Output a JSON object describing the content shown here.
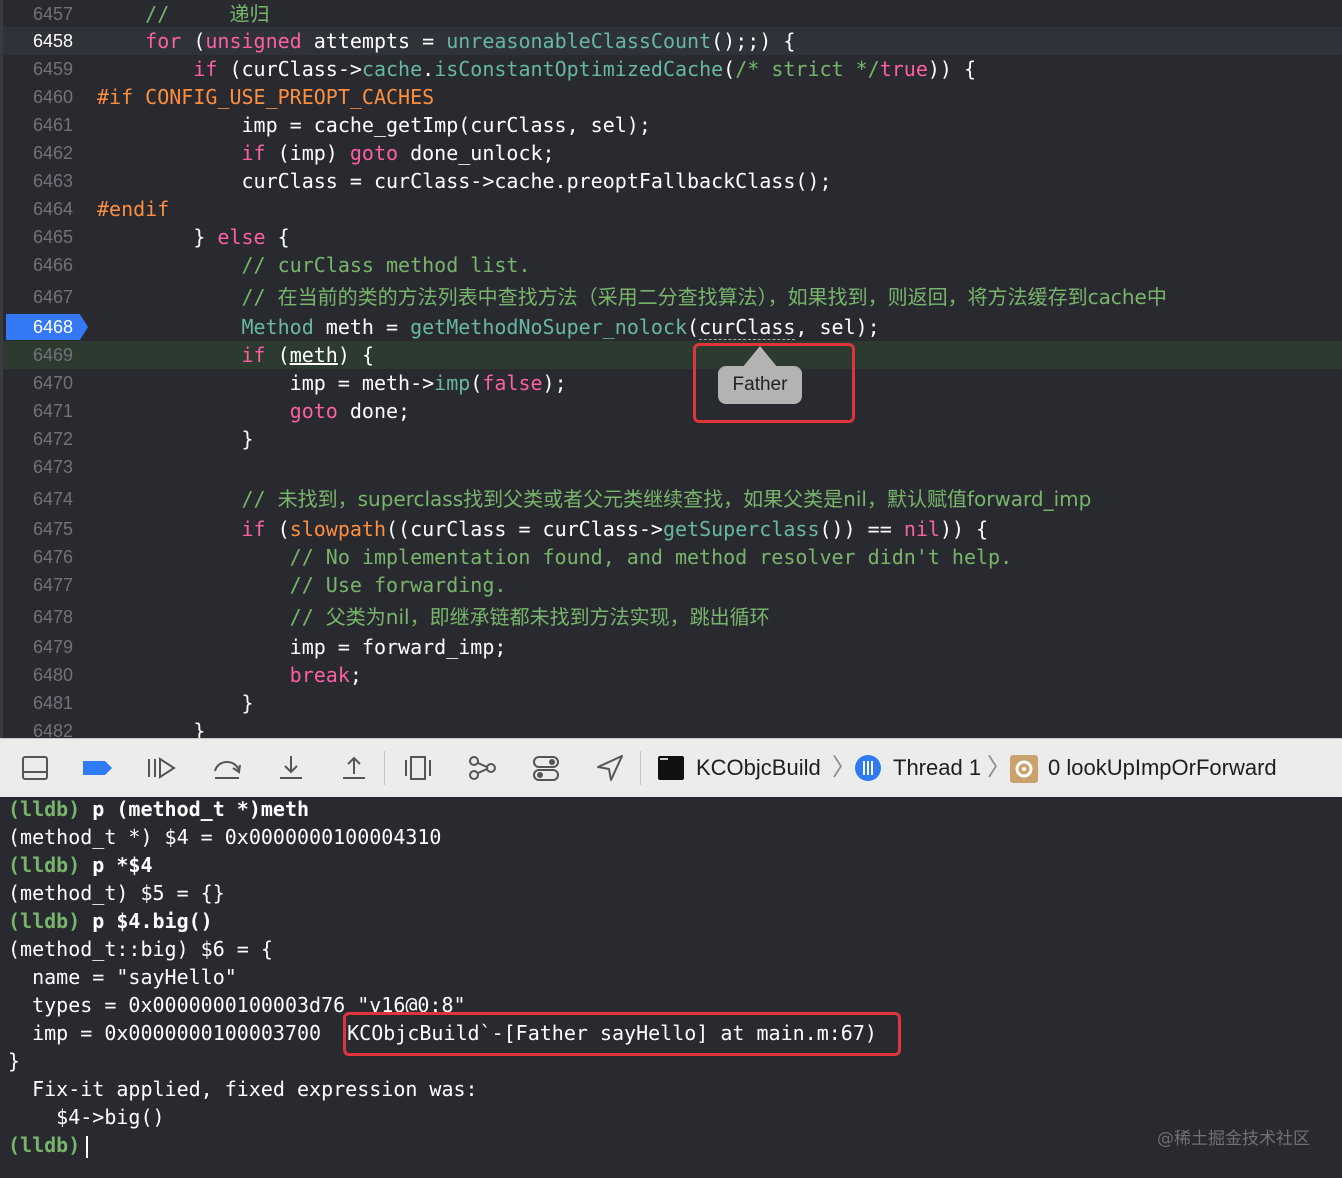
{
  "editor": {
    "lines": [
      {
        "num": "6457",
        "segments": [
          {
            "t": "    ",
            "c": ""
          },
          {
            "t": "//     ",
            "c": "c"
          },
          {
            "t": "递归",
            "c": "cn"
          }
        ]
      },
      {
        "num": "6458",
        "segments": [
          {
            "t": "    ",
            "c": ""
          },
          {
            "t": "for",
            "c": "k"
          },
          {
            "t": " (",
            "c": ""
          },
          {
            "t": "unsigned",
            "c": "k"
          },
          {
            "t": " attempts = ",
            "c": ""
          },
          {
            "t": "unreasonableClassCount",
            "c": "f"
          },
          {
            "t": "();;) {",
            "c": ""
          }
        ]
      },
      {
        "num": "6459",
        "segments": [
          {
            "t": "        ",
            "c": ""
          },
          {
            "t": "if",
            "c": "k"
          },
          {
            "t": " (curClass->",
            "c": ""
          },
          {
            "t": "cache",
            "c": "f"
          },
          {
            "t": ".",
            "c": ""
          },
          {
            "t": "isConstantOptimizedCache",
            "c": "f"
          },
          {
            "t": "(",
            "c": ""
          },
          {
            "t": "/* strict */",
            "c": "c"
          },
          {
            "t": "true",
            "c": "k"
          },
          {
            "t": ")) {",
            "c": ""
          }
        ]
      },
      {
        "num": "6460",
        "segments": [
          {
            "t": "#if CONFIG_USE_PREOPT_CACHES",
            "c": "pp"
          }
        ]
      },
      {
        "num": "6461",
        "segments": [
          {
            "t": "            imp = cache_getImp(curClass, sel);",
            "c": ""
          }
        ]
      },
      {
        "num": "6462",
        "segments": [
          {
            "t": "            ",
            "c": ""
          },
          {
            "t": "if",
            "c": "k"
          },
          {
            "t": " (imp) ",
            "c": ""
          },
          {
            "t": "goto",
            "c": "k"
          },
          {
            "t": " done_unlock;",
            "c": ""
          }
        ]
      },
      {
        "num": "6463",
        "segments": [
          {
            "t": "            curClass = curClass->cache.preoptFallbackClass();",
            "c": ""
          }
        ]
      },
      {
        "num": "6464",
        "segments": [
          {
            "t": "#endif",
            "c": "pp"
          }
        ]
      },
      {
        "num": "6465",
        "segments": [
          {
            "t": "        } ",
            "c": ""
          },
          {
            "t": "else",
            "c": "k"
          },
          {
            "t": " {",
            "c": ""
          }
        ]
      },
      {
        "num": "6466",
        "segments": [
          {
            "t": "            ",
            "c": ""
          },
          {
            "t": "// curClass method list.",
            "c": "c"
          }
        ]
      },
      {
        "num": "6467",
        "segments": [
          {
            "t": "            ",
            "c": ""
          },
          {
            "t": "// ",
            "c": "c"
          },
          {
            "t": "在当前的类的方法列表中查找方法（采用二分查找算法），如果找到，则返回，将方法缓存到cache中",
            "c": "cn"
          }
        ]
      },
      {
        "num": "6468",
        "segments": [
          {
            "t": "            ",
            "c": ""
          },
          {
            "t": "Method",
            "c": "f"
          },
          {
            "t": " meth = ",
            "c": ""
          },
          {
            "t": "getMethodNoSuper_nolock",
            "c": "f"
          },
          {
            "t": "(",
            "c": ""
          },
          {
            "t": "curClass",
            "c": "dot"
          },
          {
            "t": ", sel);",
            "c": ""
          }
        ]
      },
      {
        "num": "6469",
        "segments": [
          {
            "t": "            ",
            "c": ""
          },
          {
            "t": "if",
            "c": "k"
          },
          {
            "t": " (",
            "c": ""
          },
          {
            "t": "meth",
            "c": "ul"
          },
          {
            "t": ") {",
            "c": ""
          }
        ]
      },
      {
        "num": "6470",
        "segments": [
          {
            "t": "                imp = meth->",
            "c": ""
          },
          {
            "t": "imp",
            "c": "f"
          },
          {
            "t": "(",
            "c": ""
          },
          {
            "t": "false",
            "c": "k"
          },
          {
            "t": ");",
            "c": ""
          }
        ]
      },
      {
        "num": "6471",
        "segments": [
          {
            "t": "                ",
            "c": ""
          },
          {
            "t": "goto",
            "c": "k"
          },
          {
            "t": " done;",
            "c": ""
          }
        ]
      },
      {
        "num": "6472",
        "segments": [
          {
            "t": "            }",
            "c": ""
          }
        ]
      },
      {
        "num": "6473",
        "segments": [
          {
            "t": "",
            "c": ""
          }
        ]
      },
      {
        "num": "6474",
        "segments": [
          {
            "t": "            ",
            "c": ""
          },
          {
            "t": "// ",
            "c": "c"
          },
          {
            "t": "未找到，superclass找到父类或者父元类继续查找，如果父类是nil，默认赋值forward_imp",
            "c": "cn"
          }
        ]
      },
      {
        "num": "6475",
        "segments": [
          {
            "t": "            ",
            "c": ""
          },
          {
            "t": "if",
            "c": "k"
          },
          {
            "t": " (",
            "c": ""
          },
          {
            "t": "slowpath",
            "c": "pp"
          },
          {
            "t": "((curClass = curClass->",
            "c": ""
          },
          {
            "t": "getSuperclass",
            "c": "f"
          },
          {
            "t": "()) == ",
            "c": ""
          },
          {
            "t": "nil",
            "c": "k"
          },
          {
            "t": ")) {",
            "c": ""
          }
        ]
      },
      {
        "num": "6476",
        "segments": [
          {
            "t": "                ",
            "c": ""
          },
          {
            "t": "// No implementation found, and method resolver didn't help.",
            "c": "c"
          }
        ]
      },
      {
        "num": "6477",
        "segments": [
          {
            "t": "                ",
            "c": ""
          },
          {
            "t": "// Use forwarding.",
            "c": "c"
          }
        ]
      },
      {
        "num": "6478",
        "segments": [
          {
            "t": "                ",
            "c": ""
          },
          {
            "t": "// ",
            "c": "c"
          },
          {
            "t": "父类为nil，即继承链都未找到方法实现，跳出循环",
            "c": "cn"
          }
        ]
      },
      {
        "num": "6479",
        "segments": [
          {
            "t": "                imp = forward_imp;",
            "c": ""
          }
        ]
      },
      {
        "num": "6480",
        "segments": [
          {
            "t": "                ",
            "c": ""
          },
          {
            "t": "break",
            "c": "k"
          },
          {
            "t": ";",
            "c": ""
          }
        ]
      },
      {
        "num": "6481",
        "segments": [
          {
            "t": "            }",
            "c": ""
          }
        ]
      },
      {
        "num": "6482",
        "segments": [
          {
            "t": "        }",
            "c": ""
          }
        ]
      }
    ],
    "tooltip": "Father"
  },
  "toolbar": {
    "icons": [
      "hide-debug-area-icon",
      "breakpoints-toggle-icon",
      "continue-icon",
      "step-over-icon",
      "step-into-icon",
      "step-out-icon",
      "view-debugger-icon",
      "memory-graph-icon",
      "environment-overrides-icon",
      "simulate-location-icon"
    ],
    "breadcrumb": {
      "target": "KCObjcBuild",
      "thread": "Thread 1",
      "frame": "0 lookUpImpOrForward"
    }
  },
  "console": {
    "lines": [
      {
        "prompt": "(lldb)",
        "cmd": " p (method_t *)meth"
      },
      {
        "out": "(method_t *) $4 = 0x0000000100004310"
      },
      {
        "prompt": "(lldb)",
        "cmd": " p *$4"
      },
      {
        "out": "(method_t) $5 = {}"
      },
      {
        "prompt": "(lldb)",
        "cmd": " p $4.big()"
      },
      {
        "out": "(method_t::big) $6 = {"
      },
      {
        "out": "  name = \"sayHello\""
      },
      {
        "out": "  types = 0x0000000100003d76 \"v16@0:8\""
      },
      {
        "out": "  imp = 0x0000000100003700 ",
        "extra": "KCObjcBuild`-[Father sayHello] at main.m:67)"
      },
      {
        "out": "}"
      },
      {
        "out": "  Fix-it applied, fixed expression was:"
      },
      {
        "out": "    $4->big()"
      },
      {
        "prompt": "(lldb)",
        "cmd": ""
      }
    ]
  },
  "watermark": "@稀土掘金技术社区",
  "colors": {
    "background": "#292a30",
    "keyword": "#fc5fa3",
    "comment": "#78b56b",
    "preprocessor": "#fd8f3f",
    "function": "#67b7a4",
    "breakpoint": "#3478f6",
    "highlight_box": "#e0343a"
  }
}
